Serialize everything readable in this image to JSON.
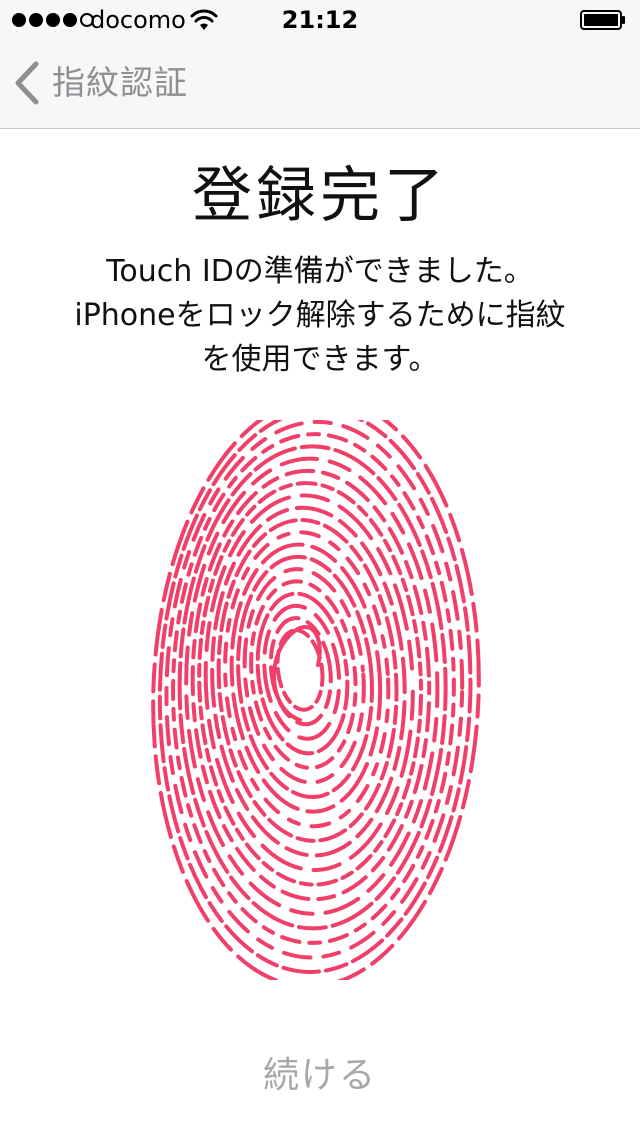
{
  "status_bar": {
    "carrier": "docomo",
    "time": "21:12",
    "signal_strength": 4,
    "signal_max": 5,
    "icons": [
      "signal-dots-icon",
      "wifi-icon",
      "battery-icon"
    ]
  },
  "nav": {
    "back_label": "指紋認証",
    "back_icon": "chevron-left-icon"
  },
  "main": {
    "title": "登録完了",
    "message_line1": "Touch IDの準備ができました。",
    "message_line2": "iPhoneをロック解除するために指紋",
    "message_line3": "を使用できます。"
  },
  "fingerprint": {
    "icon": "fingerprint-icon",
    "color": "#f0406a"
  },
  "footer": {
    "continue_label": "続ける"
  },
  "colors": {
    "nav_background": "#f7f7f8",
    "inactive_text": "#8e8e93",
    "continue_text": "#a7a7ab",
    "fingerprint": "#f0406a"
  }
}
